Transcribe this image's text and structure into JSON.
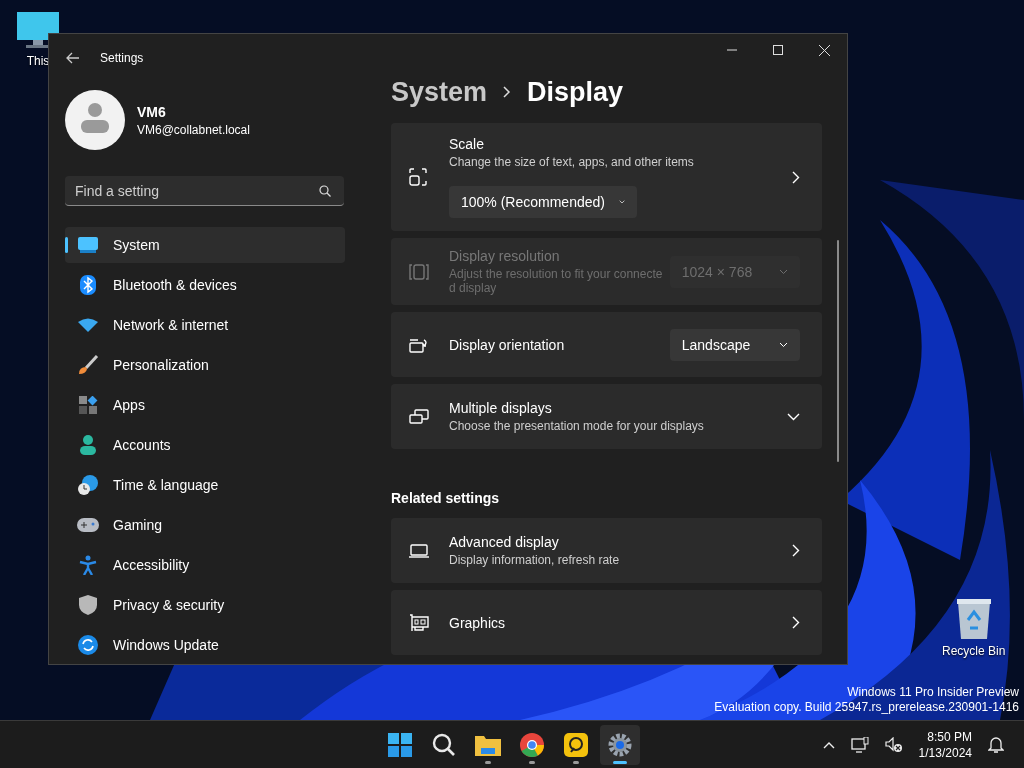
{
  "desktop": {
    "icons": [
      {
        "label": "This"
      },
      {
        "label": "Recycle Bin"
      }
    ],
    "watermark": [
      "Windows 11 Pro Insider Preview",
      "Evaluation copy. Build 25947.rs_prerelease.230901-1416"
    ]
  },
  "window": {
    "title": "Settings",
    "account": {
      "name": "VM6",
      "email": "VM6@collabnet.local"
    },
    "search": {
      "placeholder": "Find a setting"
    },
    "nav": [
      {
        "label": "System",
        "selected": true
      },
      {
        "label": "Bluetooth & devices",
        "selected": false
      },
      {
        "label": "Network & internet",
        "selected": false
      },
      {
        "label": "Personalization",
        "selected": false
      },
      {
        "label": "Apps",
        "selected": false
      },
      {
        "label": "Accounts",
        "selected": false
      },
      {
        "label": "Time & language",
        "selected": false
      },
      {
        "label": "Gaming",
        "selected": false
      },
      {
        "label": "Accessibility",
        "selected": false
      },
      {
        "label": "Privacy & security",
        "selected": false
      },
      {
        "label": "Windows Update",
        "selected": false
      }
    ],
    "breadcrumb": [
      "System",
      "Display"
    ],
    "cards": [
      {
        "kind": "link",
        "title": "Scale",
        "description": "Change the size of text, apps, and other items",
        "dropdown": "100% (Recommended)",
        "disabled": false
      },
      {
        "kind": "dropdown",
        "title": "Display resolution",
        "description": "Adjust the resolution to fit your connecte d display",
        "dropdown": "1024 × 768",
        "disabled": true
      },
      {
        "kind": "dropdown",
        "title": "Display orientation",
        "dropdown": "Landscape",
        "disabled": false
      },
      {
        "kind": "expander",
        "title": "Multiple displays",
        "description": "Choose the presentation mode for your displays",
        "disabled": false
      }
    ],
    "related_heading": "Related settings",
    "related": [
      {
        "kind": "link",
        "title": "Advanced display",
        "description": "Display information, refresh rate",
        "disabled": false
      },
      {
        "kind": "link",
        "title": "Graphics",
        "disabled": false
      }
    ]
  },
  "taskbar": {
    "apps": [
      {
        "running": false,
        "selected": false
      },
      {
        "running": false,
        "selected": false
      },
      {
        "running": true,
        "selected": false
      },
      {
        "running": true,
        "selected": false
      },
      {
        "running": true,
        "selected": false
      },
      {
        "running": true,
        "selected": true
      }
    ],
    "time": "8:50 PM",
    "date": "1/13/2024"
  }
}
